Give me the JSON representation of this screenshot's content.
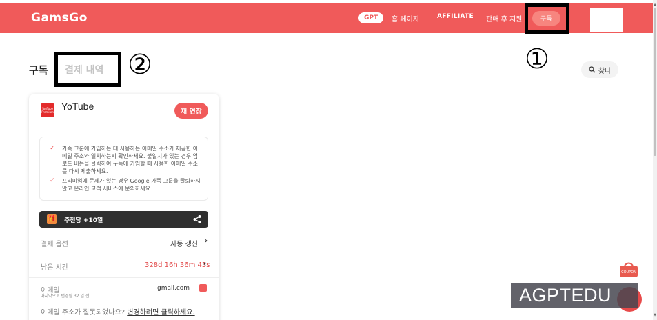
{
  "navbar": {
    "logo": "GamsGo",
    "gpt_badge": "GPT",
    "home": "홈 페이지",
    "affiliate": "AFFILIATE",
    "after_sales": "판매 후 지원",
    "subscription": "구독",
    "accent_color": "#f05a5a"
  },
  "annotations": {
    "marker_one": "①",
    "marker_two": "②"
  },
  "tabs": {
    "subscription": "구독",
    "payment_history": "결제 내역"
  },
  "search": {
    "label": "찾다",
    "icon": "search-icon"
  },
  "card": {
    "service_logo_text": "YouTube Premium",
    "service_name": "YoTube",
    "renew_label": "재 연장",
    "notices": [
      "가족 그룹에 가입하는 데 사용하는 이메일 주소가 제공한 이메일 주소와 일치하는지 확인하세요. 불일치가 있는 경우 업로드 버튼을 클릭하여 구독에 가입할 때 사용한 이메일 주소를 다시 제출하세요.",
      "프리미엄에 문제가 있는 경우 Google 가족 그룹을 탈퇴하지 말고 온라인 고객 서비스에 문의하세요."
    ],
    "referral_text": "추천당 +10일",
    "payment_option_label": "결제 옵션",
    "payment_option_value": "자동 갱신",
    "remaining_label": "남은 시간",
    "remaining_value": "328d 16h 36m 43s",
    "email_label": "이메일",
    "email_sub": "마지막으로 변경됨 32 일 전",
    "email_value": "gmail.com",
    "wrong_email_q": "이메일 주소가 잘못되었나요?",
    "wrong_email_link": "변경하려면 클릭하세요."
  },
  "floating": {
    "coupon": "COUPON",
    "watermark": "AGPTEDU"
  }
}
